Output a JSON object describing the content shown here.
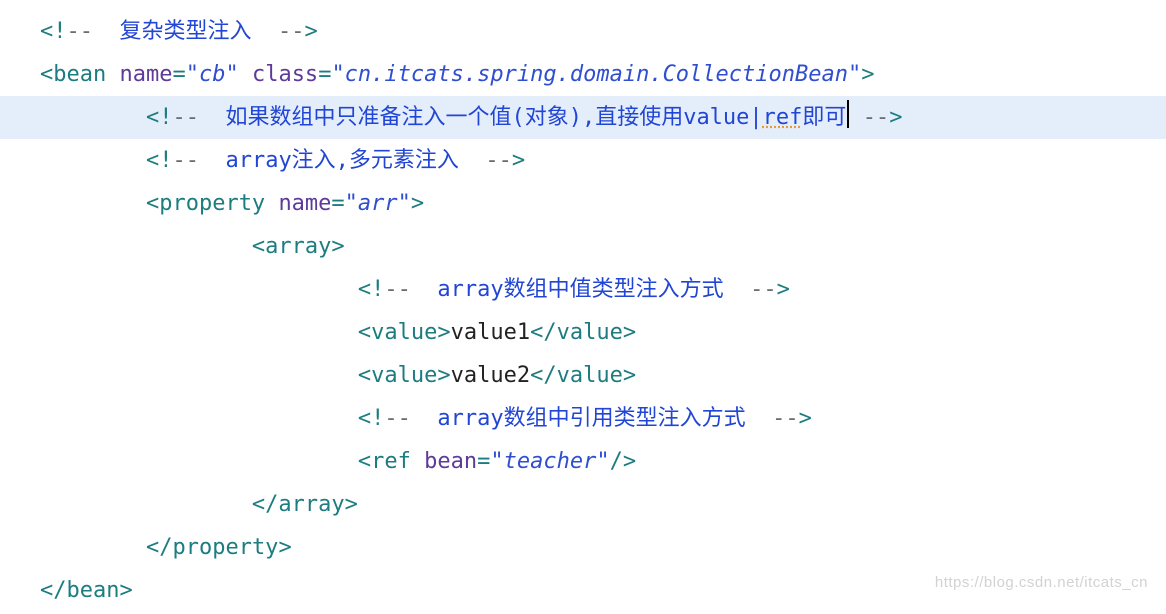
{
  "code": {
    "lines": [
      {
        "indent": 0,
        "type": "comment",
        "text": "复杂类型注入"
      },
      {
        "indent": 0,
        "type": "open_bean",
        "tag": "bean",
        "attrs": [
          {
            "name": "name",
            "value": "cb"
          },
          {
            "name": "class",
            "value": "cn.itcats.spring.domain.CollectionBean"
          }
        ]
      },
      {
        "indent": 1,
        "type": "comment_hl",
        "text_before": "如果数组中只准备注入一个值(对象),直接使用value|",
        "text_underline": "ref",
        "text_after": "即可"
      },
      {
        "indent": 1,
        "type": "comment",
        "text": "array注入,多元素注入"
      },
      {
        "indent": 1,
        "type": "open",
        "tag": "property",
        "attrs": [
          {
            "name": "name",
            "value": "arr"
          }
        ]
      },
      {
        "indent": 2,
        "type": "open_plain",
        "tag": "array"
      },
      {
        "indent": 3,
        "type": "comment",
        "text": "array数组中值类型注入方式"
      },
      {
        "indent": 3,
        "type": "valuetag",
        "tag": "value",
        "text": "value1"
      },
      {
        "indent": 3,
        "type": "valuetag",
        "tag": "value",
        "text": "value2"
      },
      {
        "indent": 3,
        "type": "comment",
        "text": "array数组中引用类型注入方式"
      },
      {
        "indent": 3,
        "type": "selfclose",
        "tag": "ref",
        "attrs": [
          {
            "name": "bean",
            "value": "teacher"
          }
        ]
      },
      {
        "indent": 2,
        "type": "close",
        "tag": "array"
      },
      {
        "indent": 1,
        "type": "close",
        "tag": "property"
      },
      {
        "indent": 0,
        "type": "close",
        "tag": "bean"
      }
    ]
  },
  "watermark": "https://blog.csdn.net/itcats_cn"
}
